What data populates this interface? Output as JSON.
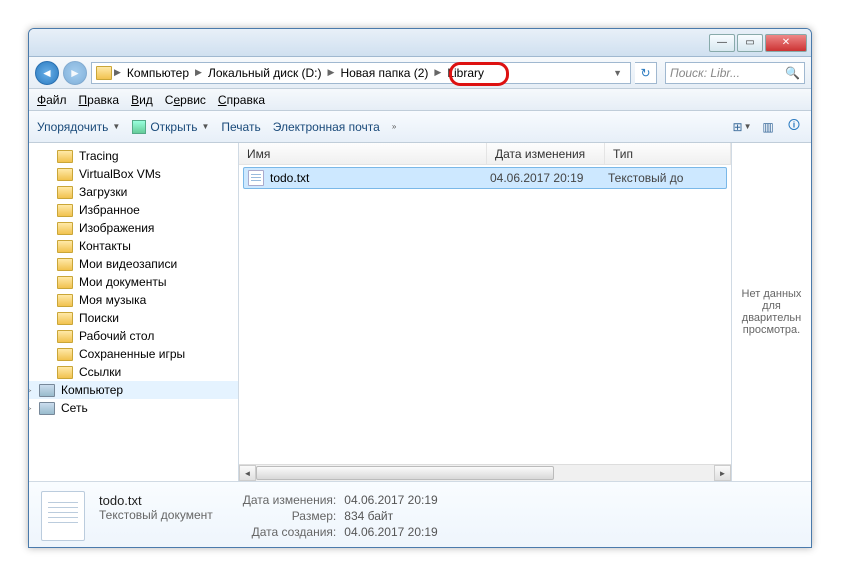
{
  "breadcrumb": [
    "Компьютер",
    "Локальный диск (D:)",
    "Новая папка (2)",
    "Library"
  ],
  "search_placeholder": "Поиск: Libr...",
  "menubar": {
    "file": "Файл",
    "edit": "Правка",
    "view": "Вид",
    "tools": "Сервис",
    "help": "Справка"
  },
  "toolbar": {
    "organize": "Упорядочить",
    "open": "Открыть",
    "print": "Печать",
    "email": "Электронная почта"
  },
  "tree": [
    "Tracing",
    "VirtualBox VMs",
    "Загрузки",
    "Избранное",
    "Изображения",
    "Контакты",
    "Мои видеозаписи",
    "Мои документы",
    "Моя музыка",
    "Поиски",
    "Рабочий стол",
    "Сохраненные игры",
    "Ссылки"
  ],
  "tree_root1": "Компьютер",
  "tree_root2": "Сеть",
  "columns": {
    "name": "Имя",
    "date": "Дата изменения",
    "type": "Тип"
  },
  "files": [
    {
      "name": "todo.txt",
      "date": "04.06.2017 20:19",
      "type": "Текстовый до"
    }
  ],
  "preview_empty": "Нет данных для дварительн просмотра.",
  "details": {
    "name": "todo.txt",
    "type": "Текстовый документ",
    "modified_label": "Дата изменения:",
    "modified": "04.06.2017 20:19",
    "size_label": "Размер:",
    "size": "834 байт",
    "created_label": "Дата создания:",
    "created": "04.06.2017 20:19"
  }
}
